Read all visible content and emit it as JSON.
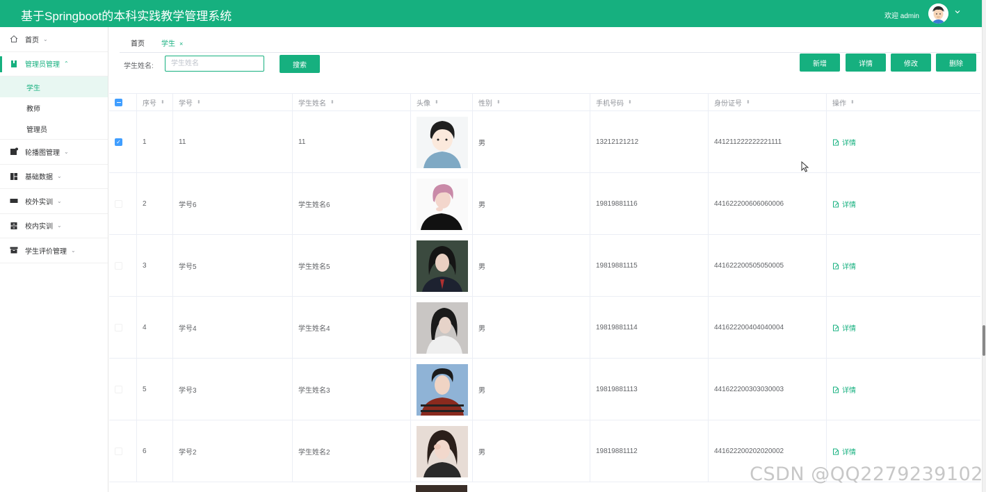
{
  "header": {
    "title": "基于Springboot的本科实践教学管理系统",
    "welcome": "欢迎 admin",
    "avatar_icon": "user-avatar-icon",
    "chevron_icon": "chevron-down-icon"
  },
  "colors": {
    "primary": "#16b07f",
    "checkbox": "#409eff",
    "submenu_active_bg": "#e8f7f2"
  },
  "sidebar": {
    "items": [
      {
        "label": "首页",
        "icon": "home-icon",
        "chevron": "⌄"
      },
      {
        "label": "管理员管理",
        "icon": "book-icon",
        "chevron": "⌃"
      },
      {
        "label": "轮播图管理",
        "icon": "image-icon",
        "chevron": "⌄"
      },
      {
        "label": "基础数据",
        "icon": "grid-icon",
        "chevron": "⌄"
      },
      {
        "label": "校外实训",
        "icon": "card-icon",
        "chevron": "⌄"
      },
      {
        "label": "校内实训",
        "icon": "server-icon",
        "chevron": "⌄"
      },
      {
        "label": "学生评价管理",
        "icon": "archive-icon",
        "chevron": "⌄"
      }
    ],
    "submenu": [
      {
        "label": "学生"
      },
      {
        "label": "教师"
      },
      {
        "label": "管理员"
      }
    ]
  },
  "tabs": [
    {
      "label": "首页"
    },
    {
      "label": "学生",
      "close": "×"
    }
  ],
  "search": {
    "label": "学生姓名:",
    "placeholder": "学生姓名",
    "button": "搜索"
  },
  "toolbar": {
    "add": "新增",
    "detail": "详情",
    "edit": "修改",
    "delete": "删除"
  },
  "table": {
    "columns": [
      "序号",
      "学号",
      "学生姓名",
      "头像",
      "性别",
      "手机号码",
      "身份证号",
      "操作"
    ],
    "sort_glyph": "⬍",
    "action_label": "详情",
    "rows": [
      {
        "index": "1",
        "student_no": "11",
        "name": "11",
        "gender": "男",
        "phone": "13212121212",
        "id_card": "441211222222221111",
        "checked": true
      },
      {
        "index": "2",
        "student_no": "学号6",
        "name": "学生姓名6",
        "gender": "男",
        "phone": "19819881116",
        "id_card": "441622200606060006",
        "checked": false
      },
      {
        "index": "3",
        "student_no": "学号5",
        "name": "学生姓名5",
        "gender": "男",
        "phone": "19819881115",
        "id_card": "441622200505050005",
        "checked": false
      },
      {
        "index": "4",
        "student_no": "学号4",
        "name": "学生姓名4",
        "gender": "男",
        "phone": "19819881114",
        "id_card": "441622200404040004",
        "checked": false
      },
      {
        "index": "5",
        "student_no": "学号3",
        "name": "学生姓名3",
        "gender": "男",
        "phone": "19819881113",
        "id_card": "441622200303030003",
        "checked": false
      },
      {
        "index": "6",
        "student_no": "学号2",
        "name": "学生姓名2",
        "gender": "男",
        "phone": "19819881112",
        "id_card": "441622200202020002",
        "checked": false
      }
    ]
  },
  "watermark": "CSDN @QQ2279239102"
}
